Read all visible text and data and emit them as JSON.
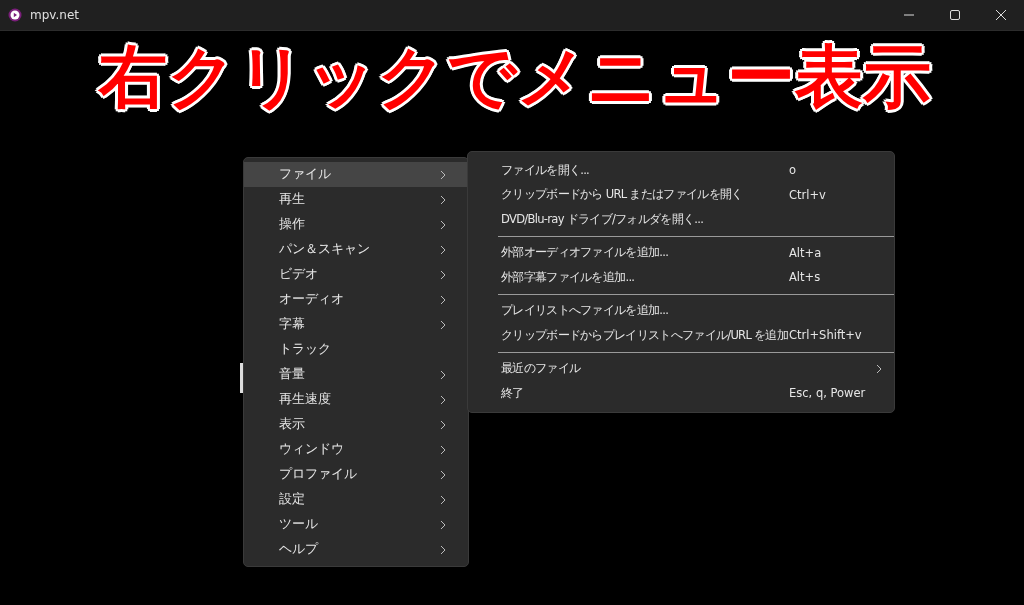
{
  "window": {
    "title": "mpv.net"
  },
  "caption": "右クリックでメニュー表示",
  "menu": {
    "items": [
      {
        "label": "ファイル",
        "has_submenu": true,
        "selected": true
      },
      {
        "label": "再生",
        "has_submenu": true,
        "selected": false
      },
      {
        "label": "操作",
        "has_submenu": true,
        "selected": false
      },
      {
        "label": "パン＆スキャン",
        "has_submenu": true,
        "selected": false
      },
      {
        "label": "ビデオ",
        "has_submenu": true,
        "selected": false
      },
      {
        "label": "オーディオ",
        "has_submenu": true,
        "selected": false
      },
      {
        "label": "字幕",
        "has_submenu": true,
        "selected": false
      },
      {
        "label": "トラック",
        "has_submenu": false,
        "selected": false
      },
      {
        "label": "音量",
        "has_submenu": true,
        "selected": false
      },
      {
        "label": "再生速度",
        "has_submenu": true,
        "selected": false
      },
      {
        "label": "表示",
        "has_submenu": true,
        "selected": false
      },
      {
        "label": "ウィンドウ",
        "has_submenu": true,
        "selected": false
      },
      {
        "label": "プロファイル",
        "has_submenu": true,
        "selected": false
      },
      {
        "label": "設定",
        "has_submenu": true,
        "selected": false
      },
      {
        "label": "ツール",
        "has_submenu": true,
        "selected": false
      },
      {
        "label": "ヘルプ",
        "has_submenu": true,
        "selected": false
      }
    ]
  },
  "submenu": {
    "items": [
      {
        "kind": "item",
        "label": "ファイルを開く...",
        "shortcut": "o"
      },
      {
        "kind": "item",
        "label": "クリップボードから URL またはファイルを開く",
        "shortcut": "Ctrl+v"
      },
      {
        "kind": "item",
        "label": "DVD/Blu-ray ドライブ/フォルダを開く..."
      },
      {
        "kind": "separator"
      },
      {
        "kind": "item",
        "label": "外部オーディオファイルを追加...",
        "shortcut": "Alt+a"
      },
      {
        "kind": "item",
        "label": "外部字幕ファイルを追加...",
        "shortcut": "Alt+s"
      },
      {
        "kind": "separator"
      },
      {
        "kind": "item",
        "label": "プレイリストへファイルを追加..."
      },
      {
        "kind": "item",
        "label": "クリップボードからプレイリストへファイル/URL を追加",
        "shortcut": "Ctrl+Shift+v"
      },
      {
        "kind": "separator"
      },
      {
        "kind": "submenu",
        "label": "最近のファイル"
      },
      {
        "kind": "item",
        "label": "終了",
        "shortcut": "Esc, q, Power"
      }
    ]
  }
}
